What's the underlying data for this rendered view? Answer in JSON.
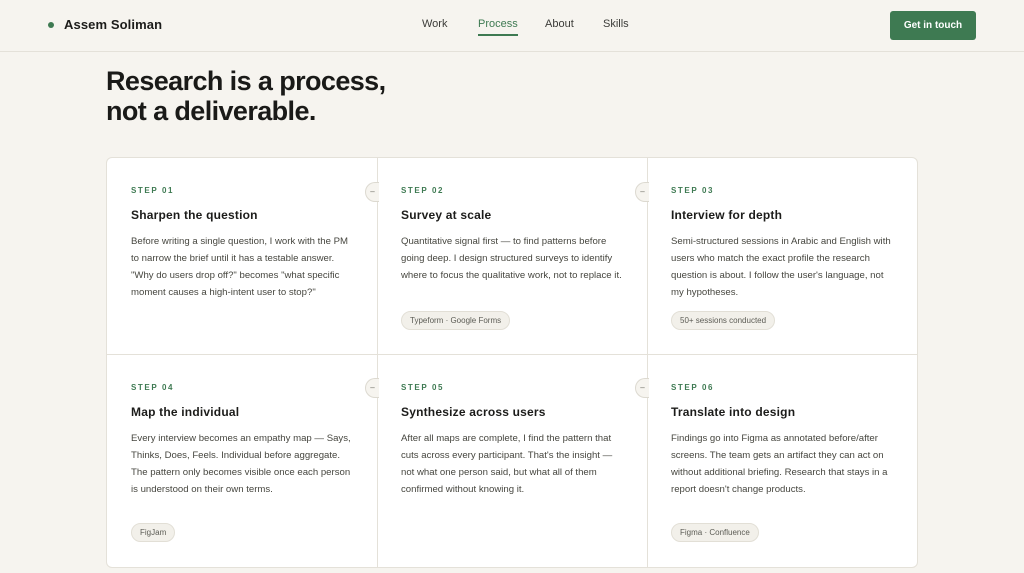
{
  "header": {
    "brand_name": "Assem Soliman",
    "nav": [
      "Work",
      "Process",
      "About",
      "Skills"
    ],
    "active_nav": "Process",
    "cta_label": "Get in touch"
  },
  "hero": {
    "line1": "Research is a process,",
    "line2": "not a deliverable."
  },
  "steps": [
    {
      "label": "STEP 01",
      "title": "Sharpen the question",
      "desc": "Before writing a single question, I work with the PM to narrow the brief until it has a testable answer. \"Why do users drop off?\" becomes \"what specific moment causes a high-intent user to stop?\"",
      "tag": ""
    },
    {
      "label": "STEP 02",
      "title": "Survey at scale",
      "desc": "Quantitative signal first — to find patterns before going deep. I design structured surveys to identify where to focus the qualitative work, not to replace it.",
      "tag": "Typeform · Google Forms"
    },
    {
      "label": "STEP 03",
      "title": "Interview for depth",
      "desc": "Semi-structured sessions in Arabic and English with users who match the exact profile the research question is about. I follow the user's language, not my hypotheses.",
      "tag": "50+ sessions conducted"
    },
    {
      "label": "STEP 04",
      "title": "Map the individual",
      "desc": "Every interview becomes an empathy map — Says, Thinks, Does, Feels. Individual before aggregate. The pattern only becomes visible once each person is understood on their own terms.",
      "tag": "FigJam"
    },
    {
      "label": "STEP 05",
      "title": "Synthesize across users",
      "desc": "After all maps are complete, I find the pattern that cuts across every participant. That's the insight — not what one person said, but what all of them confirmed without knowing it.",
      "tag": ""
    },
    {
      "label": "STEP 06",
      "title": "Translate into design",
      "desc": "Findings go into Figma as annotated before/after screens. The team gets an artifact they can act on without additional briefing. Research that stays in a report doesn't change products.",
      "tag": "Figma · Confluence"
    }
  ],
  "connector_glyph": "–"
}
